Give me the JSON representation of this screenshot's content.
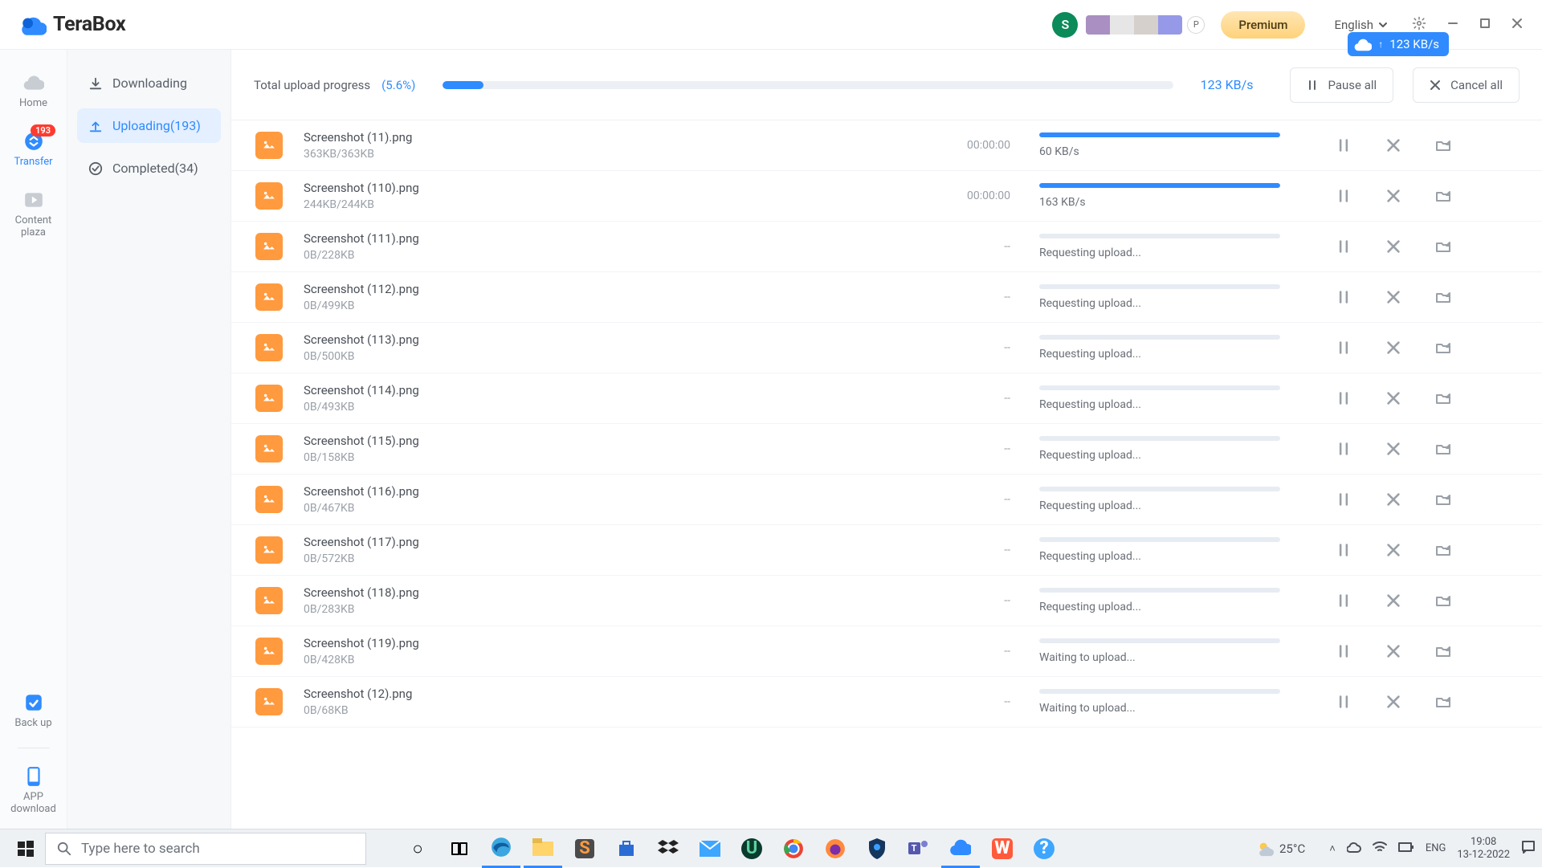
{
  "brand": "TeraBox",
  "avatar_initial": "S",
  "premium_label": "Premium",
  "language": "English",
  "speed_pill": "123 KB/s",
  "rail": {
    "home": "Home",
    "transfer": "Transfer",
    "transfer_badge": "193",
    "content_line1": "Content",
    "content_line2": "plaza",
    "backup": "Back up",
    "app_line1": "APP",
    "app_line2": "download"
  },
  "sidebar": {
    "downloading": "Downloading",
    "uploading": "Uploading(193)",
    "completed": "Completed(34)"
  },
  "header": {
    "label": "Total upload progress",
    "percent_text": "(5.6%)",
    "percent": 5.6,
    "speed": "123 KB/s",
    "pause_all": "Pause all",
    "cancel_all": "Cancel all"
  },
  "files": [
    {
      "name": "Screenshot (11).png",
      "size": "363KB/363KB",
      "time": "00:00:00",
      "progress": 100,
      "status": "60 KB/s"
    },
    {
      "name": "Screenshot (110).png",
      "size": "244KB/244KB",
      "time": "00:00:00",
      "progress": 100,
      "status": "163 KB/s"
    },
    {
      "name": "Screenshot (111).png",
      "size": "0B/228KB",
      "time": "--",
      "progress": 0,
      "status": "Requesting upload..."
    },
    {
      "name": "Screenshot (112).png",
      "size": "0B/499KB",
      "time": "--",
      "progress": 0,
      "status": "Requesting upload..."
    },
    {
      "name": "Screenshot (113).png",
      "size": "0B/500KB",
      "time": "--",
      "progress": 0,
      "status": "Requesting upload..."
    },
    {
      "name": "Screenshot (114).png",
      "size": "0B/493KB",
      "time": "--",
      "progress": 0,
      "status": "Requesting upload..."
    },
    {
      "name": "Screenshot (115).png",
      "size": "0B/158KB",
      "time": "--",
      "progress": 0,
      "status": "Requesting upload..."
    },
    {
      "name": "Screenshot (116).png",
      "size": "0B/467KB",
      "time": "--",
      "progress": 0,
      "status": "Requesting upload..."
    },
    {
      "name": "Screenshot (117).png",
      "size": "0B/572KB",
      "time": "--",
      "progress": 0,
      "status": "Requesting upload..."
    },
    {
      "name": "Screenshot (118).png",
      "size": "0B/283KB",
      "time": "--",
      "progress": 0,
      "status": "Requesting upload..."
    },
    {
      "name": "Screenshot (119).png",
      "size": "0B/428KB",
      "time": "--",
      "progress": 0,
      "status": "Waiting to upload..."
    },
    {
      "name": "Screenshot (12).png",
      "size": "0B/68KB",
      "time": "--",
      "progress": 0,
      "status": "Waiting to upload..."
    }
  ],
  "taskbar": {
    "search_placeholder": "Type here to search",
    "weather": "25°C",
    "lang": "ENG",
    "time": "19:08",
    "date": "13-12-2022"
  },
  "p_badge": "P"
}
